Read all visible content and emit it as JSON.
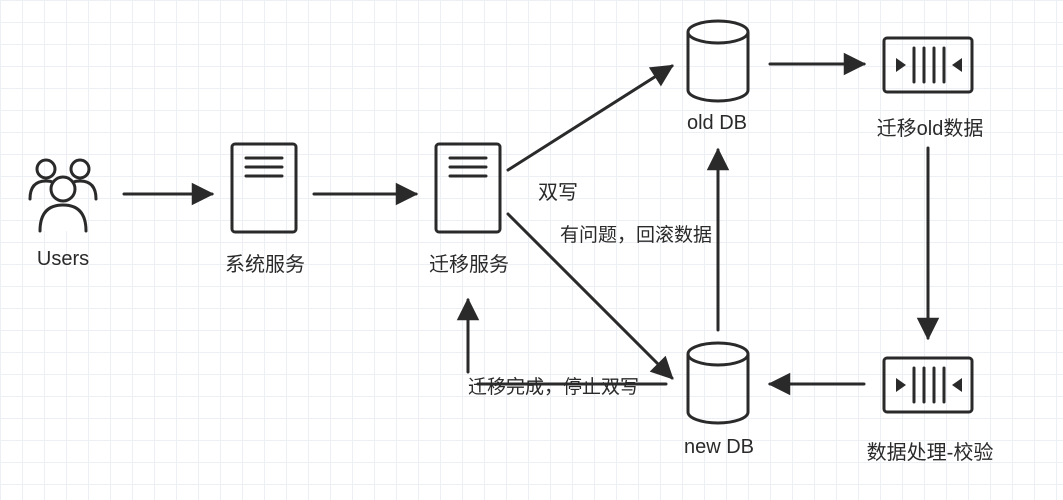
{
  "nodes": {
    "users": {
      "label": "Users"
    },
    "systemService": {
      "label": "系统服务"
    },
    "migrationService": {
      "label": "迁移服务"
    },
    "oldDb": {
      "label": "old  DB"
    },
    "newDb": {
      "label": "new DB"
    },
    "migrateOldData": {
      "label": "迁移old数据"
    },
    "dataValidate": {
      "label": "数据处理-校验"
    }
  },
  "edges": {
    "dualWrite": {
      "label": "双写"
    },
    "rollback": {
      "label": "有问题，回滚数据"
    },
    "complete": {
      "label": "迁移完成，停止双写"
    }
  },
  "stroke": "#2a2a2a"
}
